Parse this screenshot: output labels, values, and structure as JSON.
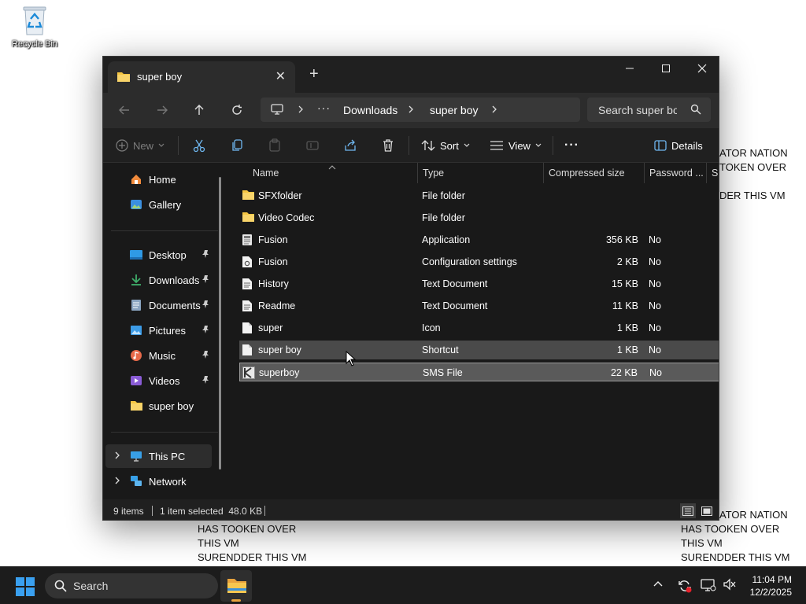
{
  "desktop": {
    "recycle_bin_label": "Recycle Bin",
    "overlay_right_top": [
      "ATOR NATION",
      "TOKEN OVER",
      "",
      "DER THIS VM"
    ],
    "overlay_right_bottom": [
      "ATOR NATION",
      "HAS TOOKEN OVER",
      "THIS VM",
      "SURENDDER THIS VM"
    ],
    "overlay_left_bottom": [
      "HAS TOOKEN OVER",
      "THIS VM",
      "SURENDDER THIS VM"
    ]
  },
  "window": {
    "tab_title": "super boy",
    "new_tab_label": "+",
    "address": {
      "more": "···",
      "segments": [
        "Downloads",
        "super boy"
      ]
    },
    "search_placeholder": "Search super boy",
    "toolbar": {
      "new_label": "New",
      "sort_label": "Sort",
      "view_label": "View",
      "more_label": "···",
      "details_label": "Details"
    },
    "sidebar": {
      "items": [
        {
          "label": "Home",
          "icon": "home-icon"
        },
        {
          "label": "Gallery",
          "icon": "gallery-icon"
        },
        {
          "label": "Desktop",
          "icon": "desktop-folder-icon",
          "pinned": true
        },
        {
          "label": "Downloads",
          "icon": "downloads-icon",
          "pinned": true
        },
        {
          "label": "Documents",
          "icon": "documents-icon",
          "pinned": true
        },
        {
          "label": "Pictures",
          "icon": "pictures-icon",
          "pinned": true
        },
        {
          "label": "Music",
          "icon": "music-icon",
          "pinned": true
        },
        {
          "label": "Videos",
          "icon": "videos-icon",
          "pinned": true
        },
        {
          "label": "super boy",
          "icon": "folder-icon"
        },
        {
          "label": "This PC",
          "icon": "this-pc-icon"
        },
        {
          "label": "Network",
          "icon": "network-icon"
        }
      ]
    },
    "columns": [
      "Name",
      "Type",
      "Compressed size",
      "Password ...",
      "S"
    ],
    "files": [
      {
        "name": "SFXfolder",
        "type": "File folder",
        "size": "",
        "password": "",
        "icon": "folder-icon"
      },
      {
        "name": "Video Codec",
        "type": "File folder",
        "size": "",
        "password": "",
        "icon": "folder-icon"
      },
      {
        "name": "Fusion",
        "type": "Application",
        "size": "356 KB",
        "password": "No",
        "icon": "application-icon"
      },
      {
        "name": "Fusion",
        "type": "Configuration settings",
        "size": "2 KB",
        "password": "No",
        "icon": "settings-file-icon"
      },
      {
        "name": "History",
        "type": "Text Document",
        "size": "15 KB",
        "password": "No",
        "icon": "text-file-icon"
      },
      {
        "name": "Readme",
        "type": "Text Document",
        "size": "11 KB",
        "password": "No",
        "icon": "text-file-icon"
      },
      {
        "name": "super",
        "type": "Icon",
        "size": "1 KB",
        "password": "No",
        "icon": "generic-file-icon"
      },
      {
        "name": "super boy",
        "type": "Shortcut",
        "size": "1 KB",
        "password": "No",
        "icon": "generic-file-icon"
      },
      {
        "name": "superboy",
        "type": "SMS File",
        "size": "22 KB",
        "password": "No",
        "icon": "sms-file-icon"
      }
    ],
    "status": {
      "items_count": "9 items",
      "selection": "1 item selected  48.0 KB"
    }
  },
  "taskbar": {
    "search_label": "Search",
    "time": "11:04 PM",
    "date": "12/2/2025"
  },
  "colors": {
    "accent_folder": "#f4c542",
    "window_bg": "#191919",
    "selection_bg": "#5a5a5a"
  }
}
